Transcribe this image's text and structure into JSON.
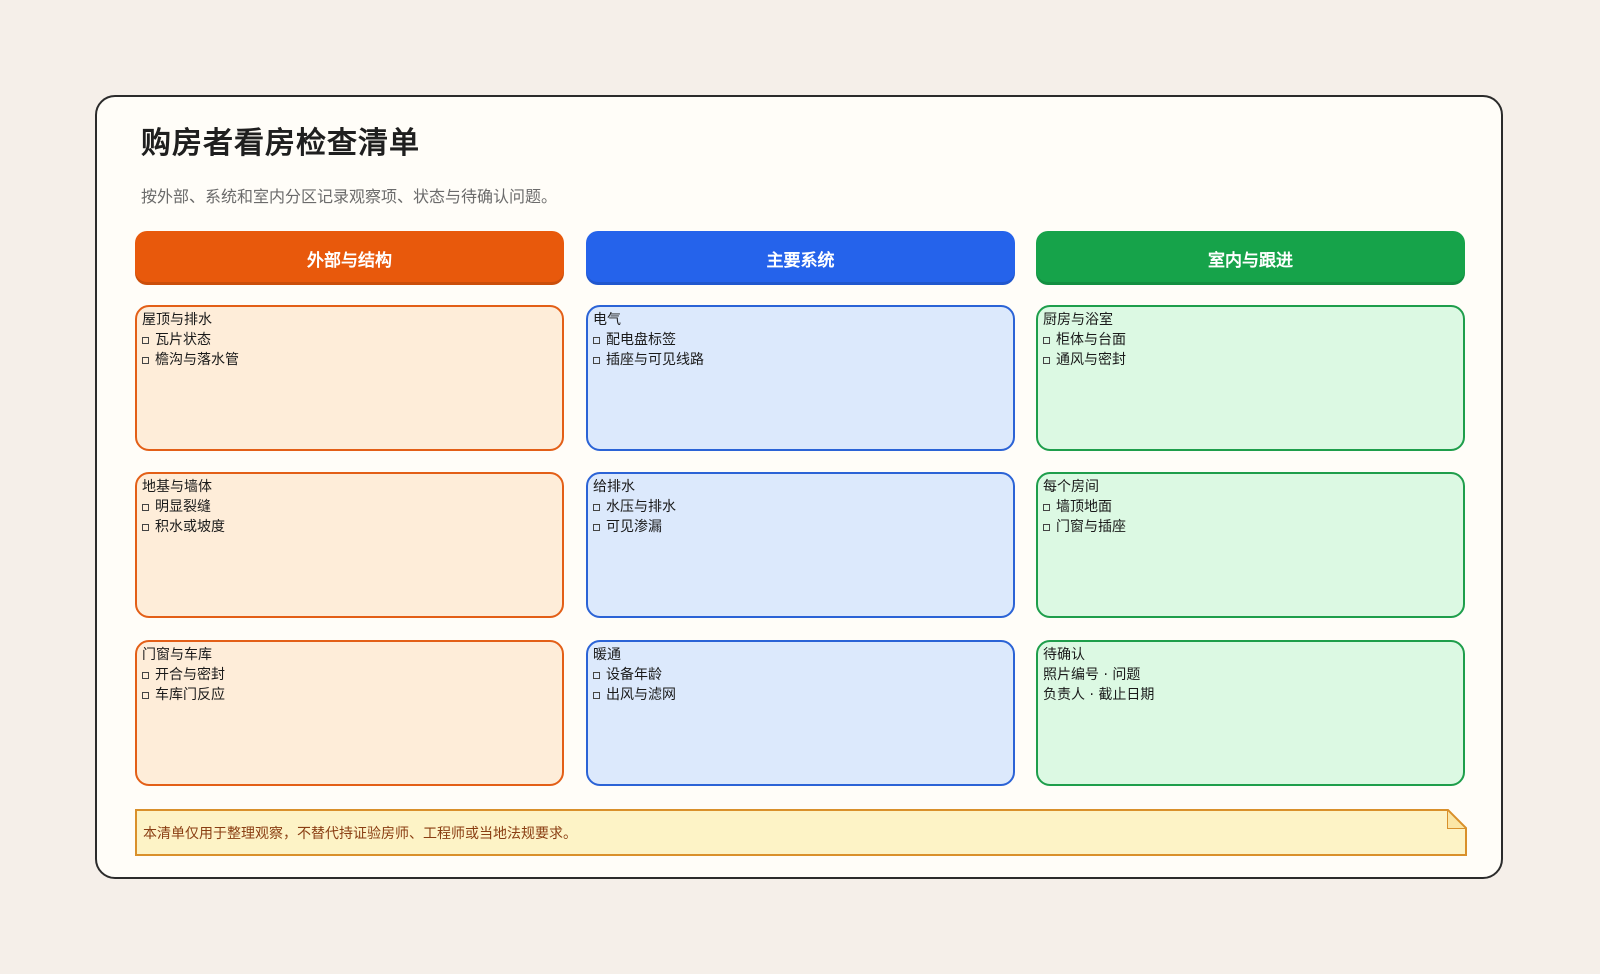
{
  "title": "购房者看房检查清单",
  "subtitle": "按外部、系统和室内分区记录观察项、状态与待确认问题。",
  "colors": {
    "orange": "#e8590c",
    "blue": "#2563eb",
    "green": "#16a34a"
  },
  "columns": [
    {
      "header": "外部与结构",
      "color": "orange"
    },
    {
      "header": "主要系统",
      "color": "blue"
    },
    {
      "header": "室内与跟进",
      "color": "green"
    }
  ],
  "panels": {
    "roof": {
      "title": "屋顶与排水",
      "items": [
        "瓦片状态",
        "檐沟与落水管"
      ]
    },
    "foundation": {
      "title": "地基与墙体",
      "items": [
        "明显裂缝",
        "积水或坡度"
      ]
    },
    "doors": {
      "title": "门窗与车库",
      "items": [
        "开合与密封",
        "车库门反应"
      ]
    },
    "electrical": {
      "title": "电气",
      "items": [
        "配电盘标签",
        "插座与可见线路"
      ]
    },
    "plumbing": {
      "title": "给排水",
      "items": [
        "水压与排水",
        "可见渗漏"
      ]
    },
    "hvac": {
      "title": "暖通",
      "items": [
        "设备年龄",
        "出风与滤网"
      ]
    },
    "kitchen": {
      "title": "厨房与浴室",
      "items": [
        "柜体与台面",
        "通风与密封"
      ]
    },
    "rooms": {
      "title": "每个房间",
      "items": [
        "墙顶地面",
        "门窗与插座"
      ]
    },
    "followup": {
      "title": "待确认",
      "lines": [
        "照片编号 · 问题",
        "负责人 · 截止日期"
      ]
    }
  },
  "note": "本清单仅用于整理观察，不替代持证验房师、工程师或当地法规要求。"
}
